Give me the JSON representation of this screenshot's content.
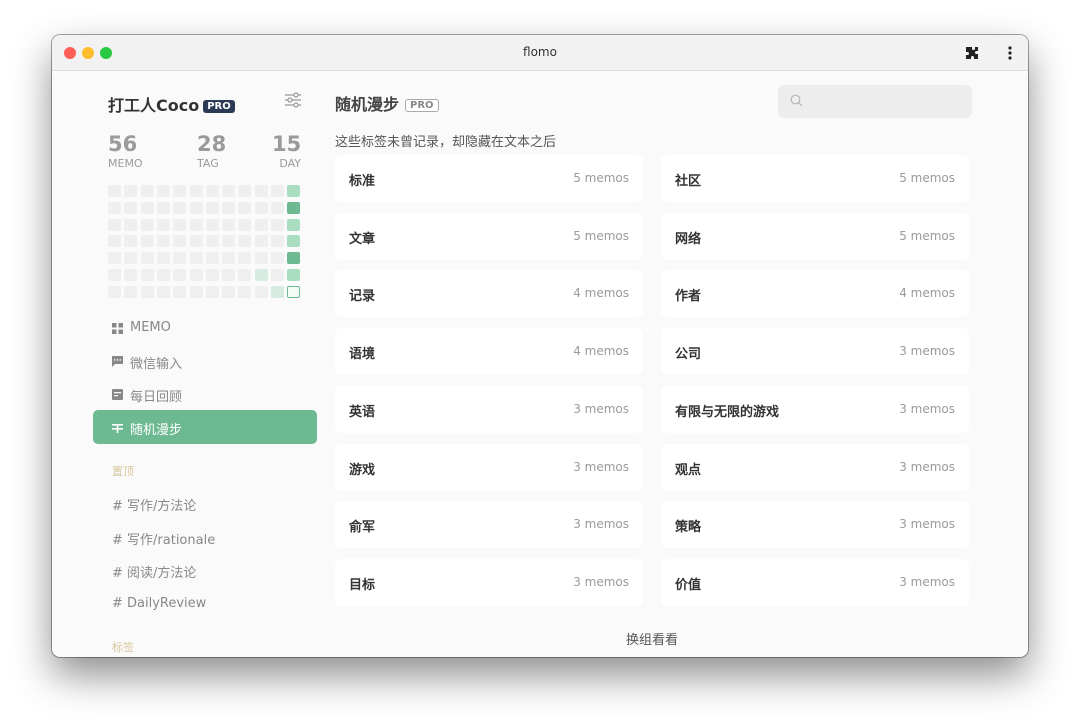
{
  "window": {
    "title": "flomo"
  },
  "user": {
    "name": "打工人Coco",
    "badge": "PRO"
  },
  "stats": [
    {
      "value": "56",
      "label": "MEMO"
    },
    {
      "value": "28",
      "label": "TAG"
    },
    {
      "value": "15",
      "label": "DAY"
    }
  ],
  "colors": {
    "accent": "#6db992",
    "heat_empty": "#efefef",
    "heat_light": "#a9dfc0",
    "heat_mid": "#6db992",
    "heat_pale": "#d6ece0",
    "badge_dark": "#2b3a55"
  },
  "nav": [
    {
      "label": "MEMO",
      "icon": "grid-icon",
      "active": false
    },
    {
      "label": "微信输入",
      "icon": "chat-icon",
      "active": false
    },
    {
      "label": "每日回顾",
      "icon": "calendar-icon",
      "active": false
    },
    {
      "label": "随机漫步",
      "icon": "shuffle-icon",
      "active": true
    }
  ],
  "pinned": {
    "label": "置顶",
    "items": [
      "# 写作/方法论",
      "# 写作/rationale",
      "# 阅读/方法论",
      "# DailyReview"
    ]
  },
  "tags_section": {
    "label": "标签"
  },
  "main": {
    "title": "随机漫步",
    "badge": "PRO",
    "subtitle": "这些标签未曾记录，却隐藏在文本之后",
    "search_placeholder": "",
    "shuffle_label": "换组看看",
    "tags": [
      {
        "name": "标准",
        "count": "5 memos"
      },
      {
        "name": "社区",
        "count": "5 memos"
      },
      {
        "name": "文章",
        "count": "5 memos"
      },
      {
        "name": "网络",
        "count": "5 memos"
      },
      {
        "name": "记录",
        "count": "4 memos"
      },
      {
        "name": "作者",
        "count": "4 memos"
      },
      {
        "name": "语境",
        "count": "4 memos"
      },
      {
        "name": "公司",
        "count": "3 memos"
      },
      {
        "name": "英语",
        "count": "3 memos"
      },
      {
        "name": "有限与无限的游戏",
        "count": "3 memos"
      },
      {
        "name": "游戏",
        "count": "3 memos"
      },
      {
        "name": "观点",
        "count": "3 memos"
      },
      {
        "name": "俞军",
        "count": "3 memos"
      },
      {
        "name": "策略",
        "count": "3 memos"
      },
      {
        "name": "目标",
        "count": "3 memos"
      },
      {
        "name": "价值",
        "count": "3 memos"
      }
    ]
  }
}
